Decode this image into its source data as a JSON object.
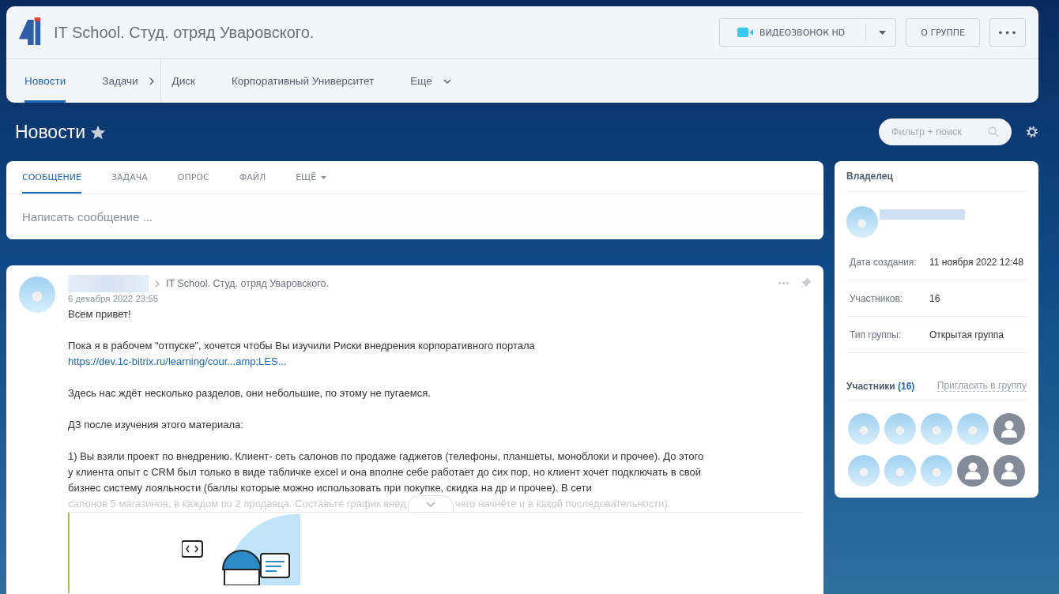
{
  "header": {
    "title": "IT School. Студ. отряд Уваровского.",
    "buttons": [
      {
        "kind": "video",
        "label": "ВИДЕОЗВОНОК HD"
      },
      {
        "kind": "text",
        "label": "О ГРУППЕ"
      },
      {
        "kind": "more",
        "label": "•••"
      }
    ]
  },
  "nav": [
    {
      "label": "Новости",
      "selected": true,
      "kind": "plain"
    },
    {
      "label": "Задачи",
      "selected": false,
      "kind": "arrow"
    },
    {
      "label": "Диск",
      "selected": false,
      "kind": "plain"
    },
    {
      "label": "Корпоративный Университет",
      "selected": false,
      "kind": "plain"
    },
    {
      "label": "Еще",
      "selected": false,
      "kind": "dropdown"
    }
  ],
  "page_title": "Новости",
  "filter": {
    "placeholder": "Фильтр + поиск"
  },
  "composer": {
    "tabs": [
      {
        "label": "СООБЩЕНИЕ",
        "selected": true,
        "kind": "plain"
      },
      {
        "label": "ЗАДАЧА",
        "selected": false,
        "kind": "plain"
      },
      {
        "label": "ОПРОС",
        "selected": false,
        "kind": "plain"
      },
      {
        "label": "ФАЙЛ",
        "selected": false,
        "kind": "plain"
      },
      {
        "label": "ЕЩЁ",
        "selected": false,
        "kind": "dropdown"
      }
    ],
    "placeholder": "Написать сообщение ..."
  },
  "post": {
    "destination": "IT School. Студ. отряд Уваровского.",
    "date": "6 декабря 2022 23:55",
    "paragraphs": [
      {
        "kind": "text",
        "text": "Всем привет!"
      },
      {
        "kind": "link",
        "text": "Пока я в рабочем \"отпуске\", хочется чтобы Вы изучили Риски внедрения корпоративного портала",
        "link": "https://dev.1c-bitrix.ru/learning/cour...amp;LES..."
      },
      {
        "kind": "text",
        "text": "Здесь нас ждёт несколько разделов, они небольшие, по этому не пугаемся."
      },
      {
        "kind": "text",
        "text": "ДЗ после изучения этого материала:"
      },
      {
        "kind": "text",
        "text": "1) Вы взяли проект по внедрению. Клиент- сеть салонов по продаже гаджетов (телефоны, планшеты, моноблоки и прочее). До этого у клиента опыт с CRM был только в виде табличке excel и она вполне себе работает до сих пор, но клиент хочет подключать в свой бизнес систему лояльности (баллы которые можно использовать при покупке, скидка на др и прочее). В сети"
      }
    ],
    "faded_line": [
      "салонов 5 магазинов, в каждом по 2 продавца. Составьте график внед",
      "чего начнёте и в какой последовательности)."
    ]
  },
  "sidebar": {
    "owner_label": "Владелец",
    "rows": [
      {
        "label": "Дата создания:",
        "value": "11 ноября 2022 12:48"
      },
      {
        "label": "Участников:",
        "value": "16"
      },
      {
        "label": "Тип группы:",
        "value": "Открытая группа"
      }
    ],
    "members_label": "Участники",
    "members_count": "(16)",
    "invite": "Пригласить в группу",
    "members": [
      {
        "kind": "photo"
      },
      {
        "kind": "photo"
      },
      {
        "kind": "photo"
      },
      {
        "kind": "photo"
      },
      {
        "kind": "default"
      },
      {
        "kind": "photo"
      },
      {
        "kind": "photo"
      },
      {
        "kind": "photo"
      },
      {
        "kind": "default"
      },
      {
        "kind": "default"
      }
    ]
  }
}
